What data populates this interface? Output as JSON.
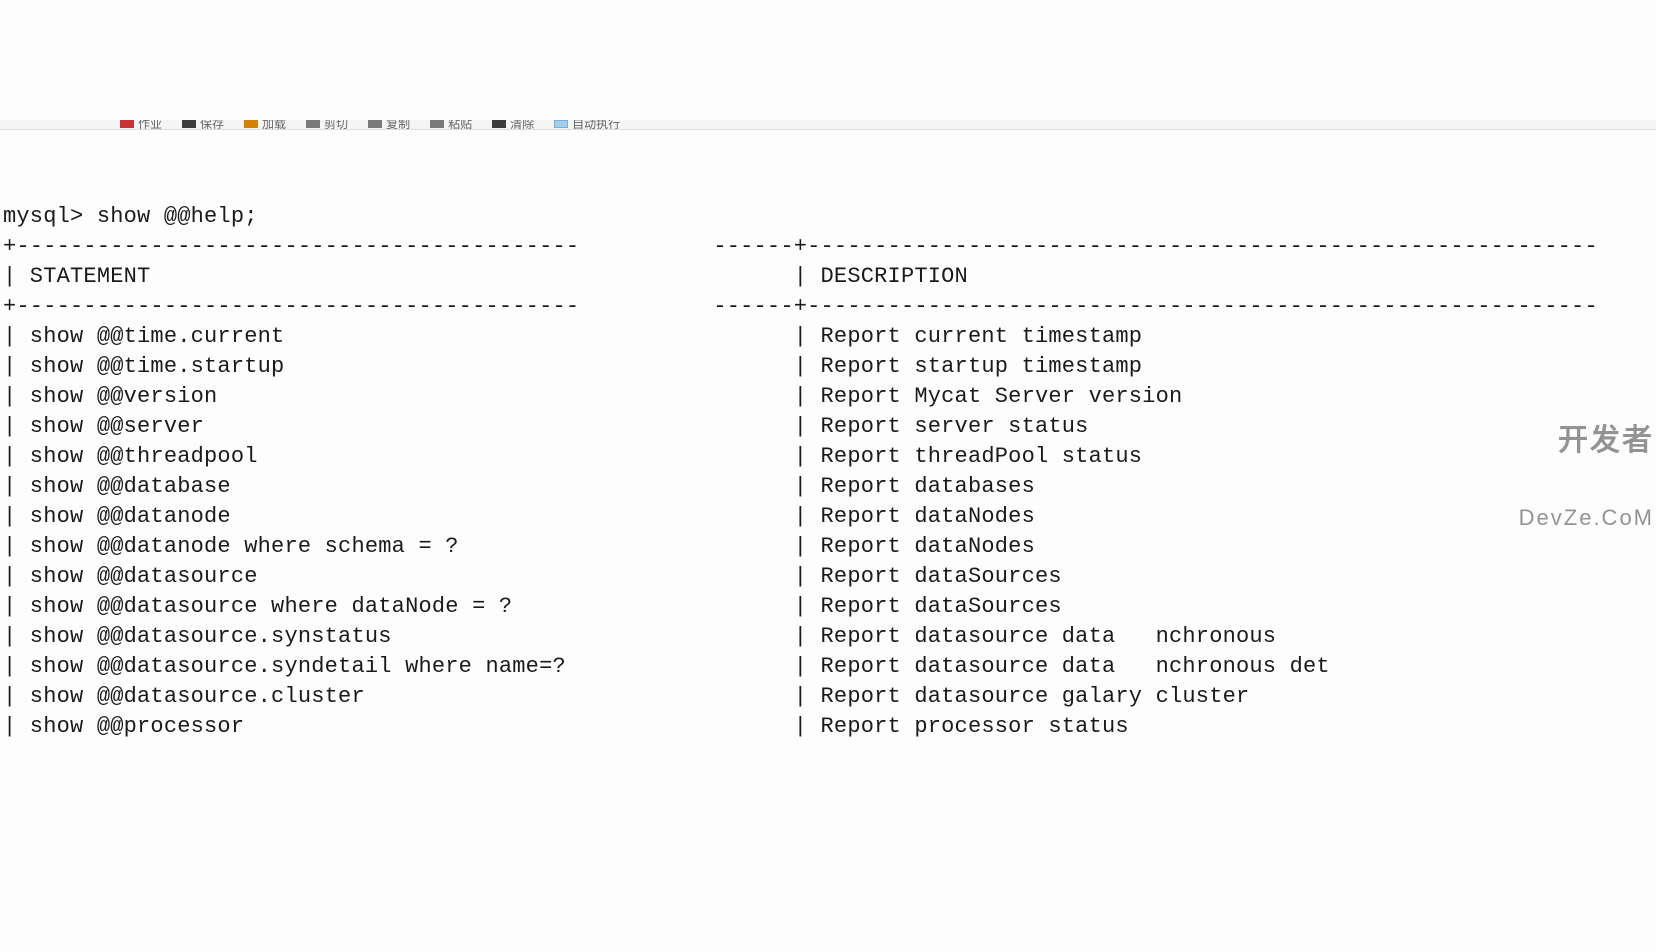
{
  "toolbar": {
    "items": [
      {
        "icon": "red",
        "label": "作业"
      },
      {
        "icon": "dark",
        "label": "保存"
      },
      {
        "icon": "orange",
        "label": "加载"
      },
      {
        "icon": "gray",
        "label": "剪切"
      },
      {
        "icon": "gray",
        "label": "复制"
      },
      {
        "icon": "gray",
        "label": "粘贴"
      },
      {
        "icon": "grid",
        "label": "清除"
      },
      {
        "icon": "blue",
        "label": "自动执行"
      }
    ]
  },
  "console": {
    "prompt": "mysql> show @@help;",
    "header_statement": "STATEMENT",
    "header_description": "DESCRIPTION",
    "rows": [
      {
        "stmt": "show @@time.current",
        "desc": "Report current timestamp"
      },
      {
        "stmt": "show @@time.startup",
        "desc": "Report startup timestamp"
      },
      {
        "stmt": "show @@version",
        "desc": "Report Mycat Server version"
      },
      {
        "stmt": "show @@server",
        "desc": "Report server status"
      },
      {
        "stmt": "show @@threadpool",
        "desc": "Report threadPool status"
      },
      {
        "stmt": "show @@database",
        "desc": "Report databases"
      },
      {
        "stmt": "show @@datanode",
        "desc": "Report dataNodes"
      },
      {
        "stmt": "show @@datanode where schema = ?",
        "desc": "Report dataNodes"
      },
      {
        "stmt": "show @@datasource",
        "desc": "Report dataSources"
      },
      {
        "stmt": "show @@datasource where dataNode = ?",
        "desc": "Report dataSources"
      },
      {
        "stmt": "show @@datasource.synstatus",
        "desc": "Report datasource data   nchronous"
      },
      {
        "stmt": "show @@datasource.syndetail where name=?",
        "desc": "Report datasource data   nchronous det"
      },
      {
        "stmt": "show @@datasource.cluster",
        "desc": "Report datasource galary cluster"
      },
      {
        "stmt": "show @@processor",
        "desc": "Report processor status"
      }
    ],
    "col1_width": 57,
    "border_col1_dashes": 42,
    "border_gap": 10,
    "border_col2_dashes": 59
  },
  "watermark": {
    "line1": "开发者",
    "line2": "DevZe.CoM"
  }
}
